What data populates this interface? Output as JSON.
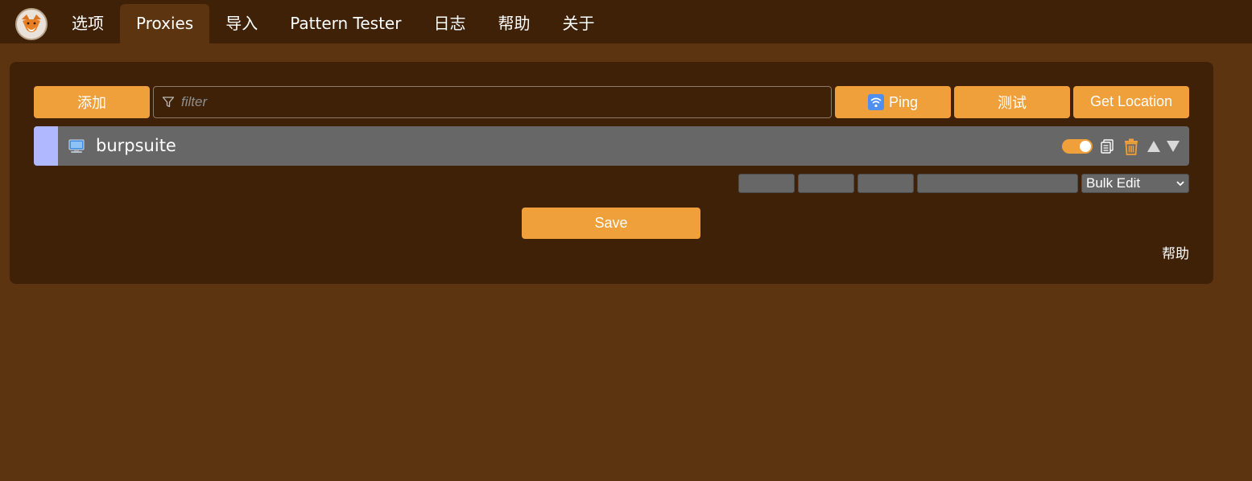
{
  "nav": {
    "tabs": [
      {
        "label": "选项",
        "active": false
      },
      {
        "label": "Proxies",
        "active": true
      },
      {
        "label": "导入",
        "active": false
      },
      {
        "label": "Pattern Tester",
        "active": false
      },
      {
        "label": "日志",
        "active": false
      },
      {
        "label": "帮助",
        "active": false
      },
      {
        "label": "关于",
        "active": false
      }
    ]
  },
  "toolbar": {
    "add_label": "添加",
    "filter_placeholder": "filter",
    "ping_label": "Ping",
    "test_label": "测试",
    "get_location_label": "Get Location"
  },
  "proxies": [
    {
      "title": "burpsuite",
      "color": "#b0b8ff",
      "enabled": true,
      "icon": "computer-icon"
    }
  ],
  "bulk": {
    "selected": "Bulk Edit"
  },
  "footer": {
    "save_label": "Save",
    "help_label": "帮助"
  },
  "colors": {
    "accent": "#f0a03a",
    "page_bg": "#5c340f",
    "panel_bg": "#3e2107",
    "row_bg": "#676767"
  }
}
